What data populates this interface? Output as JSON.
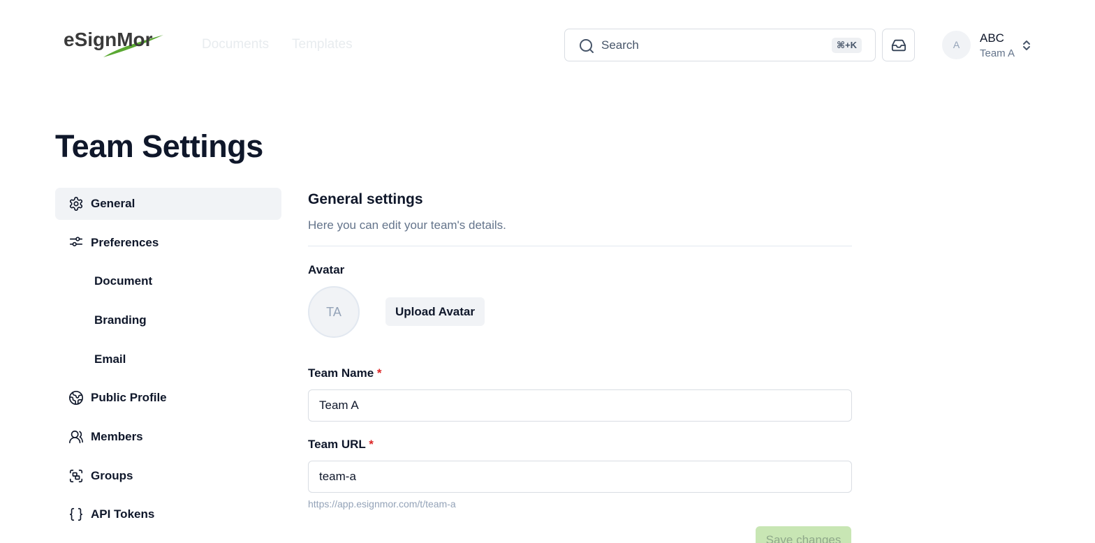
{
  "header": {
    "logo_text": "eSignMor",
    "nav": [
      "Documents",
      "Templates"
    ],
    "search": {
      "placeholder": "Search",
      "shortcut": "⌘+K"
    },
    "account": {
      "avatar_initial": "A",
      "name": "ABC",
      "team": "Team A"
    }
  },
  "page_title": "Team Settings",
  "sidebar": {
    "items": [
      {
        "label": "General",
        "icon": "gear-icon",
        "active": true
      },
      {
        "label": "Preferences",
        "icon": "sliders-icon"
      },
      {
        "label": "Document",
        "sub": true
      },
      {
        "label": "Branding",
        "sub": true
      },
      {
        "label": "Email",
        "sub": true
      },
      {
        "label": "Public Profile",
        "icon": "globe-icon"
      },
      {
        "label": "Members",
        "icon": "users-icon"
      },
      {
        "label": "Groups",
        "icon": "groups-icon"
      },
      {
        "label": "API Tokens",
        "icon": "braces-icon"
      }
    ]
  },
  "main": {
    "title": "General settings",
    "subtitle": "Here you can edit your team's details.",
    "avatar_label": "Avatar",
    "avatar_initials": "TA",
    "upload_button": "Upload Avatar",
    "team_name_label": "Team Name",
    "team_name_value": "Team A",
    "team_url_label": "Team URL",
    "team_url_value": "team-a",
    "team_url_hint": "https://app.esignmor.com/t/team-a",
    "required_mark": "*",
    "save_button": "Save changes"
  },
  "colors": {
    "accent_green": "#c8e6b4",
    "required_red": "#dc2626",
    "active_bg": "#f1f3f6"
  }
}
